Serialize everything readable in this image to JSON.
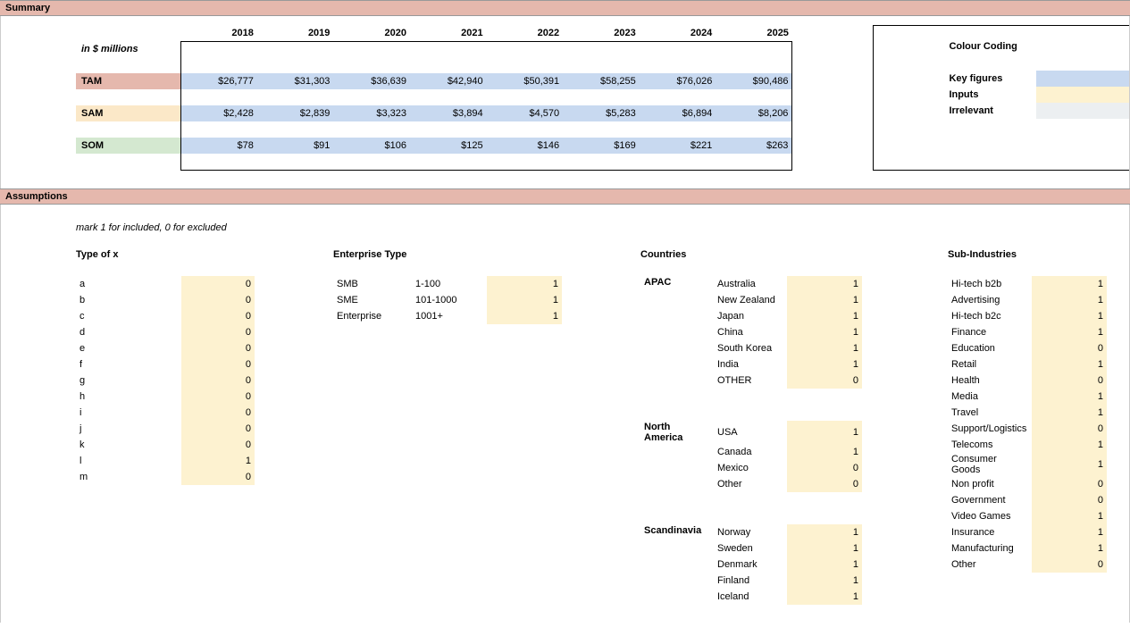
{
  "sections": {
    "summary": "Summary",
    "assumptions": "Assumptions"
  },
  "summary": {
    "unit_note": "in $ millions",
    "years": [
      "2018",
      "2019",
      "2020",
      "2021",
      "2022",
      "2023",
      "2024",
      "2025"
    ],
    "rows": [
      {
        "label": "TAM",
        "cls": "tag-tam",
        "vals": [
          "$26,777",
          "$31,303",
          "$36,639",
          "$42,940",
          "$50,391",
          "$58,255",
          "$76,026",
          "$90,486"
        ]
      },
      {
        "label": "SAM",
        "cls": "tag-sam",
        "vals": [
          "$2,428",
          "$2,839",
          "$3,323",
          "$3,894",
          "$4,570",
          "$5,283",
          "$6,894",
          "$8,206"
        ]
      },
      {
        "label": "SOM",
        "cls": "tag-som",
        "vals": [
          "$78",
          "$91",
          "$106",
          "$125",
          "$146",
          "$169",
          "$221",
          "$263"
        ]
      }
    ]
  },
  "legend": {
    "title": "Colour Coding",
    "items": [
      {
        "label": "Key figures",
        "cls": "keyfig"
      },
      {
        "label": "Inputs",
        "cls": "inputs"
      },
      {
        "label": "Irrelevant",
        "cls": "irrelevant"
      }
    ]
  },
  "assumptions": {
    "note": "mark 1 for included, 0 for excluded",
    "type_x": {
      "title": "Type of x",
      "rows": [
        [
          "a",
          "0"
        ],
        [
          "b",
          "0"
        ],
        [
          "c",
          "0"
        ],
        [
          "d",
          "0"
        ],
        [
          "e",
          "0"
        ],
        [
          "f",
          "0"
        ],
        [
          "g",
          "0"
        ],
        [
          "h",
          "0"
        ],
        [
          "i",
          "0"
        ],
        [
          "j",
          "0"
        ],
        [
          "k",
          "0"
        ],
        [
          "l",
          "1"
        ],
        [
          "m",
          "0"
        ]
      ]
    },
    "enterprise": {
      "title": "Enterprise Type",
      "rows": [
        [
          "SMB",
          "1-100",
          "1"
        ],
        [
          "SME",
          "101-1000",
          "1"
        ],
        [
          "Enterprise",
          "1001+",
          "1"
        ]
      ]
    },
    "countries": {
      "title": "Countries",
      "groups": [
        {
          "region": "APAC",
          "rows": [
            [
              "Australia",
              "1"
            ],
            [
              "New Zealand",
              "1"
            ],
            [
              "Japan",
              "1"
            ],
            [
              "China",
              "1"
            ],
            [
              "South Korea",
              "1"
            ],
            [
              "India",
              "1"
            ],
            [
              "OTHER",
              "0"
            ]
          ]
        },
        {
          "region": "North America",
          "rows": [
            [
              "USA",
              "1"
            ],
            [
              "Canada",
              "1"
            ],
            [
              "Mexico",
              "0"
            ],
            [
              "Other",
              "0"
            ]
          ]
        },
        {
          "region": "Scandinavia",
          "rows": [
            [
              "Norway",
              "1"
            ],
            [
              "Sweden",
              "1"
            ],
            [
              "Denmark",
              "1"
            ],
            [
              "Finland",
              "1"
            ],
            [
              "Iceland",
              "1"
            ]
          ]
        }
      ]
    },
    "subind": {
      "title": "Sub-Industries",
      "rows": [
        [
          "Hi-tech b2b",
          "1"
        ],
        [
          "Advertising",
          "1"
        ],
        [
          "Hi-tech b2c",
          "1"
        ],
        [
          "Finance",
          "1"
        ],
        [
          "Education",
          "0"
        ],
        [
          "Retail",
          "1"
        ],
        [
          "Health",
          "0"
        ],
        [
          "Media",
          "1"
        ],
        [
          "Travel",
          "1"
        ],
        [
          "Support/Logistics",
          "0"
        ],
        [
          "Telecoms",
          "1"
        ],
        [
          "Consumer Goods",
          "1"
        ],
        [
          "Non profit",
          "0"
        ],
        [
          "Government",
          "0"
        ],
        [
          "Video Games",
          "1"
        ],
        [
          "Insurance",
          "1"
        ],
        [
          "Manufacturing",
          "1"
        ],
        [
          "Other",
          "0"
        ]
      ]
    }
  }
}
